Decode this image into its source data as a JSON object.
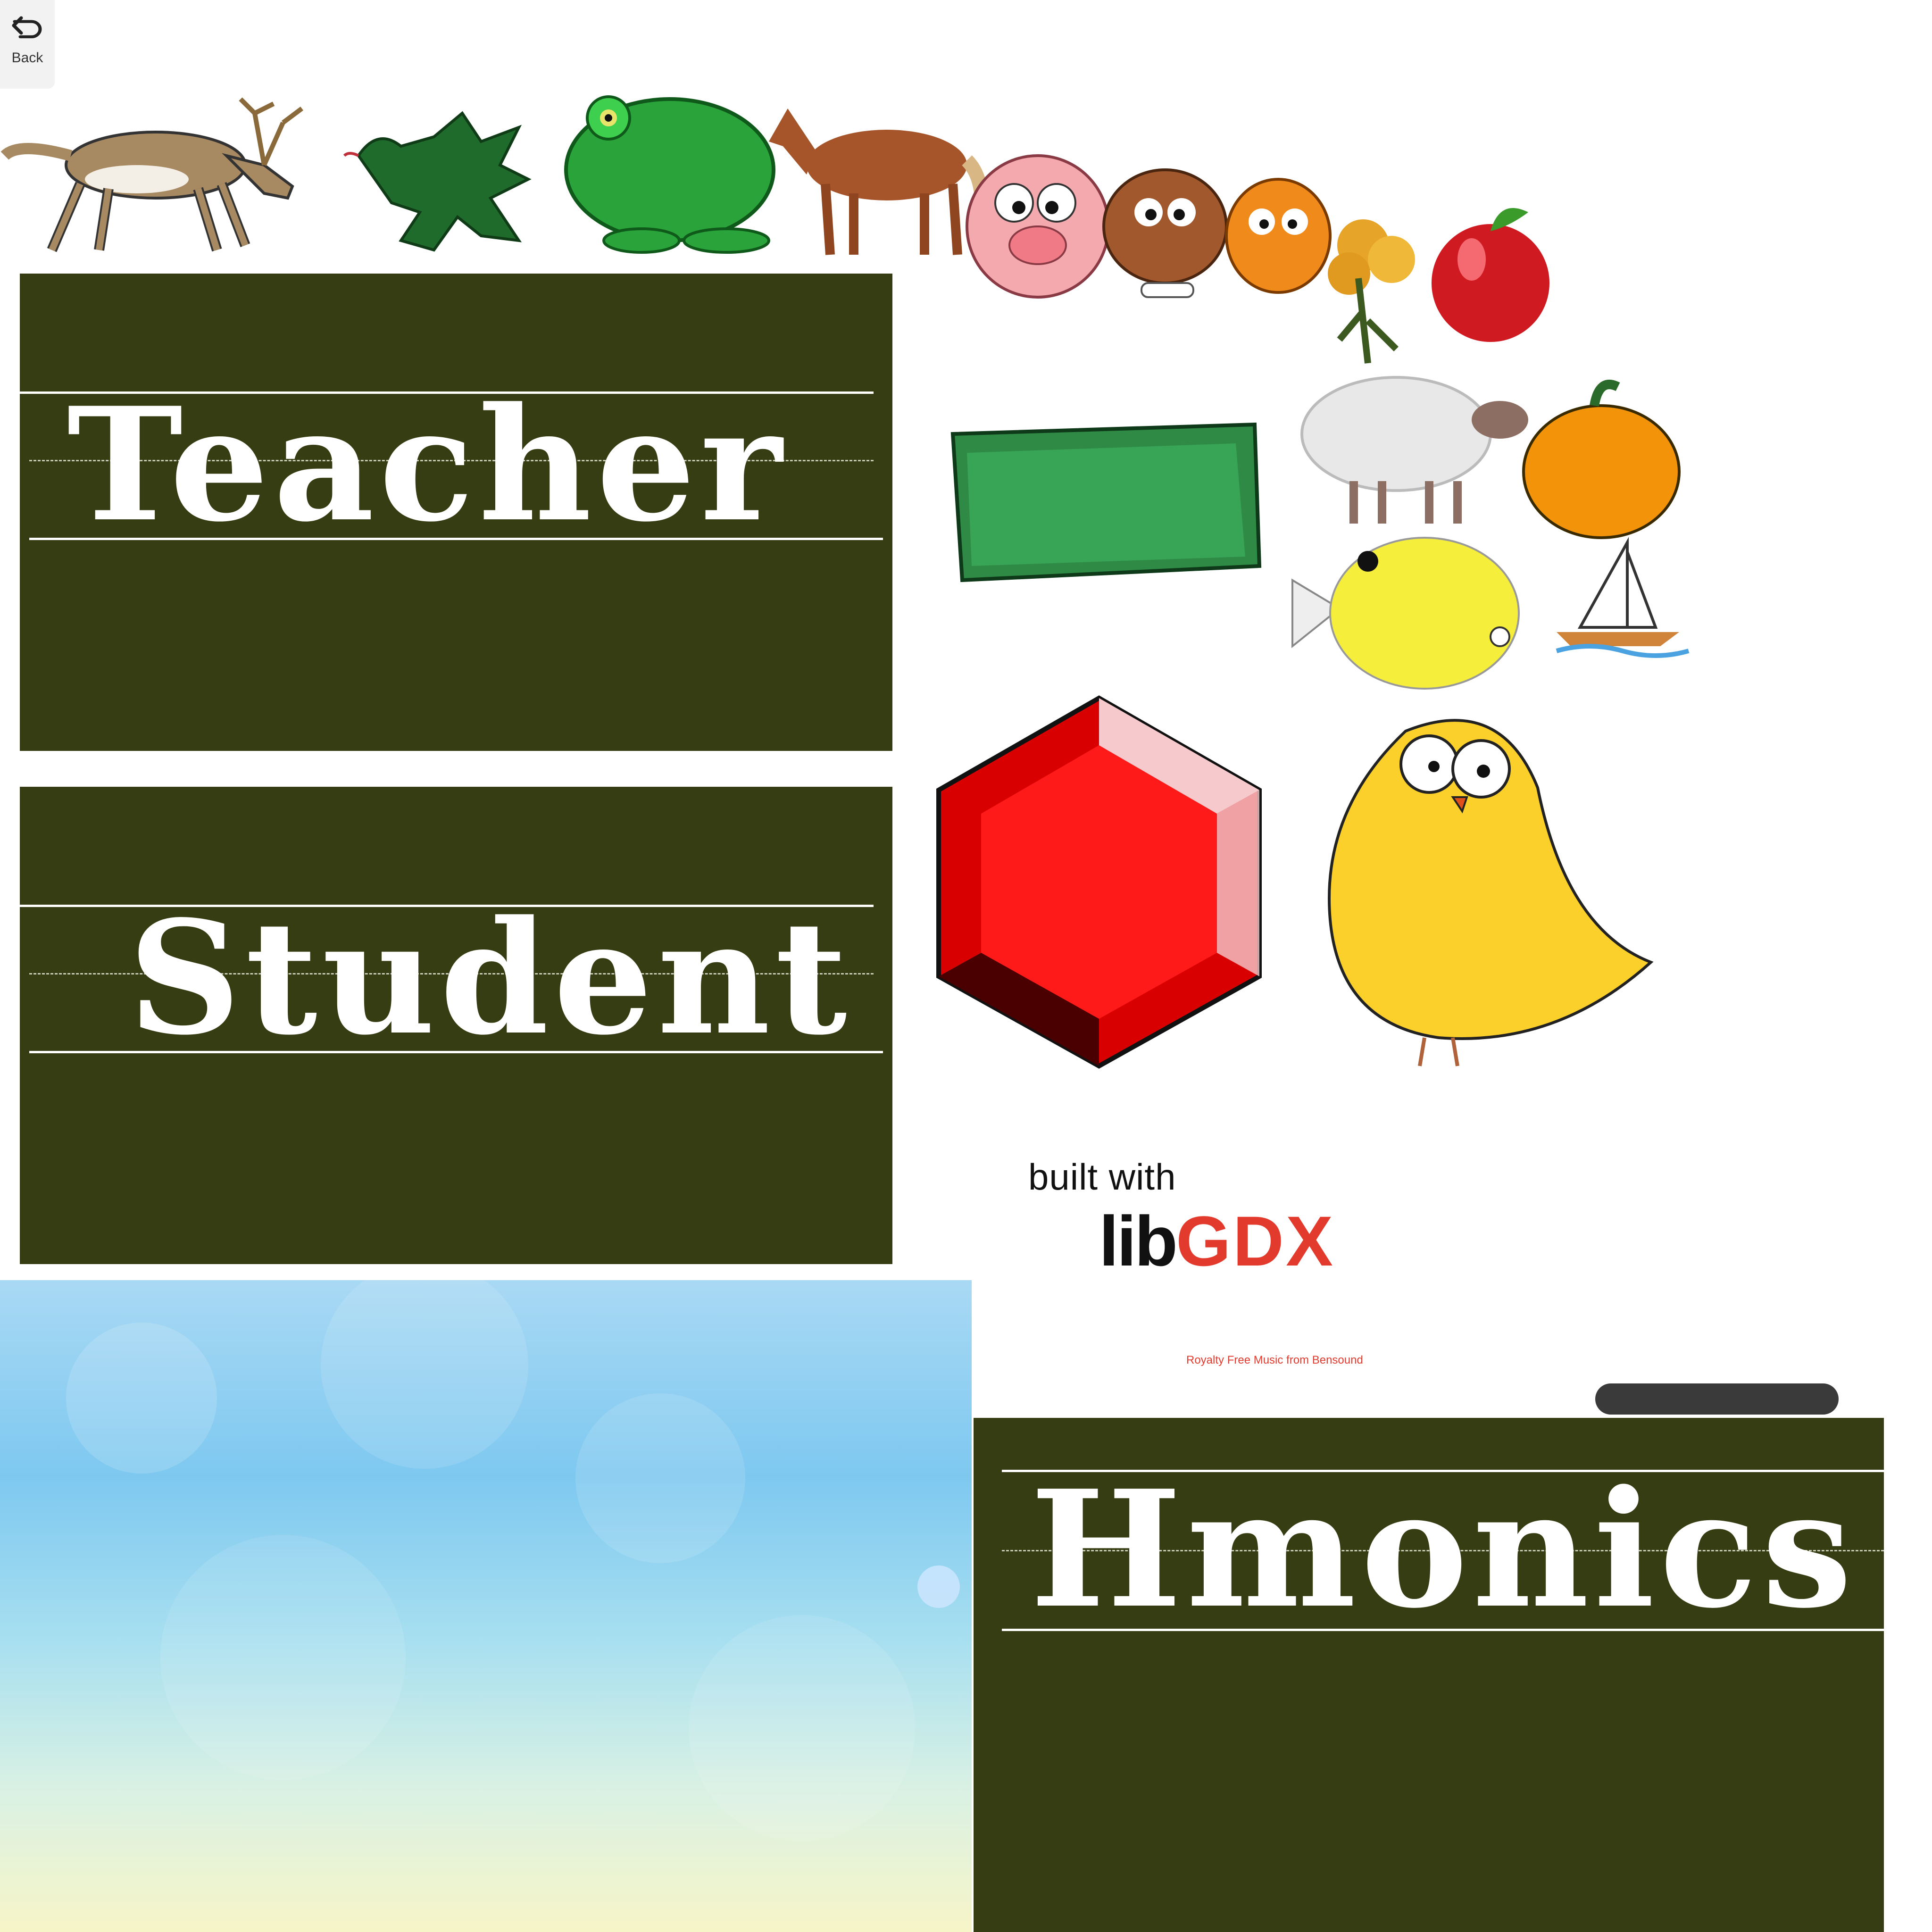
{
  "back_button": {
    "label": "Back",
    "icon": "undo-arrow-icon"
  },
  "menu": {
    "teacher_label": "Teacher",
    "student_label": "Student",
    "app_title": "Hmonics"
  },
  "branding": {
    "built_with": "built with",
    "logo_lib": "lib",
    "logo_gdx": "GDX"
  },
  "credit": "Royalty Free Music from Bensound",
  "colors": {
    "chalkboard": "#363d12",
    "chalk": "#ffffff",
    "libgdx_red": "#e23b2e"
  },
  "pictures": [
    "deer",
    "dragon",
    "frog",
    "horse",
    "pig",
    "dog",
    "cat",
    "flower",
    "apple",
    "money",
    "sheep",
    "pumpkin",
    "fish",
    "sailboat",
    "ruby",
    "chick"
  ]
}
